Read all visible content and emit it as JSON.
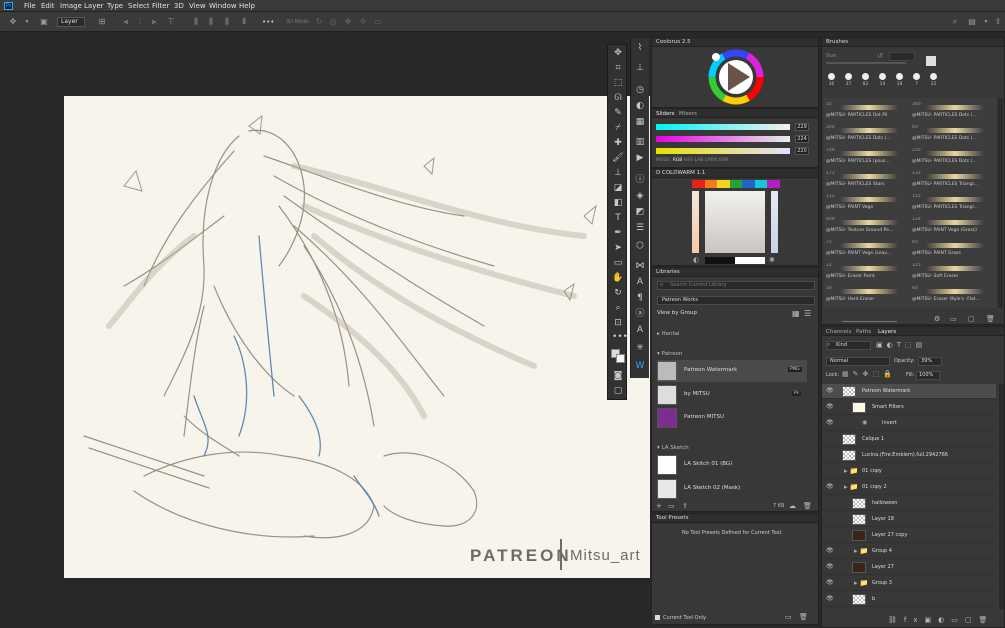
{
  "app": {
    "logo": "Ps"
  },
  "menu": [
    "File",
    "Edit",
    "Image",
    "Layer",
    "Type",
    "Select",
    "Filter",
    "3D",
    "View",
    "Window",
    "Help"
  ],
  "options": {
    "layer_select": "Layer",
    "mode_3d": "3D Mode:",
    "more": "•••"
  },
  "artwork": {
    "watermark_left": "PATREON",
    "watermark_right": "Mitsu_art"
  },
  "coolorus": {
    "title": "Coolorus 2.5"
  },
  "sliders": {
    "tab_active": "Sliders",
    "tab_other": "Mixers",
    "values": [
      "229",
      "224",
      "220"
    ],
    "modes": [
      "MODE:",
      "RGB",
      "HSV",
      "LAB",
      "CMYK",
      "B/W"
    ]
  },
  "swatch_panel": {
    "title": "D COLDWARM 1.1",
    "colors": [
      "#e8231b",
      "#f47c1c",
      "#f7d21e",
      "#22a338",
      "#1f64c8",
      "#13c9d6",
      "#b31fc2"
    ]
  },
  "libraries": {
    "title": "Libraries",
    "search_placeholder": "Search Current Library",
    "library_name": "Patreon Works",
    "view_by": "View by Group",
    "groups": [
      {
        "name": "Hentai",
        "items": []
      },
      {
        "name": "Patreon",
        "items": [
          {
            "label": "Patreon Watermark",
            "badge": "PNG"
          },
          {
            "label": "by MITSU",
            "badge": "Ps"
          },
          {
            "label": "Patreon MITSU",
            "badge": ""
          }
        ]
      },
      {
        "name": "LA Sketch",
        "items": [
          {
            "label": "LA Skitch 01 (BG)",
            "badge": ""
          },
          {
            "label": "LA Sketch 02 (Mask)",
            "badge": ""
          }
        ]
      }
    ],
    "footer_size": "7 KB"
  },
  "tool_presets": {
    "title": "Tool Presets",
    "empty_message": "No Tool Presets Defined for Current Tool.",
    "current_tool_only": "Current Tool Only"
  },
  "brushes": {
    "title": "Brushes",
    "size_label": "Size",
    "sizes": [
      "36",
      "37",
      "82",
      "14",
      "18",
      "7",
      "22"
    ],
    "rows": [
      {
        "num_left": "25",
        "left": "@MITSU- PARTICLES Dot Pil",
        "num_right": "360",
        "right": "@MITSU- PARTICLES Dots (..."
      },
      {
        "num_left": "204",
        "left": "@MITSU- PARTICLES Dots (...",
        "num_right": "60",
        "right": "@MITSU- PARTICLES Dots (..."
      },
      {
        "num_left": "749",
        "left": "@MITSU- PARTICLES (pous...",
        "num_right": "250",
        "right": "@MITSU- PARTICLES Dots (..."
      },
      {
        "num_left": "173",
        "left": "@MITSU- PARTICLES Stars",
        "num_right": "133",
        "right": "@MITSU- PARTICLES Triangl..."
      },
      {
        "num_left": "112",
        "left": "@MITSU- PAINT Vege",
        "num_right": "155",
        "right": "@MITSU- PARTICLES Triangl..."
      },
      {
        "num_left": "409",
        "left": "@MITSU- Texture Ground Pe...",
        "num_right": "124",
        "right": "@MITSU- PAINT Vege (Grass)"
      },
      {
        "num_left": "75",
        "left": "@MITSU- PAINT Vege (Leav...",
        "num_right": "60",
        "right": "@MITSU- PAINT Grass"
      },
      {
        "num_left": "12",
        "left": "@MITSU- Eraser Paint",
        "num_right": "125",
        "right": "@MITSU- Soft Eraser"
      },
      {
        "num_left": "30",
        "left": "@MITSU- Hard Eraser",
        "num_right": "60",
        "right": "@MITSU- Eraser (Kyle's -Flat..."
      }
    ]
  },
  "layers": {
    "tabs": [
      "Channels",
      "Paths",
      "Layers"
    ],
    "kind": "Kind",
    "blend": "Normal",
    "opacity_label": "Opacity:",
    "opacity": "39%",
    "lock_label": "Lock:",
    "fill_label": "Fill:",
    "fill": "100%",
    "items": [
      {
        "name": "Patreon Watermark",
        "visible": true,
        "indent": 0,
        "thumb": "checker"
      },
      {
        "name": "Smart Filters",
        "visible": true,
        "indent": 1,
        "thumb": "white"
      },
      {
        "name": "Invert",
        "visible": true,
        "indent": 2,
        "thumb": "none"
      },
      {
        "name": "Calque 1",
        "visible": false,
        "indent": 0,
        "thumb": "checker"
      },
      {
        "name": "Lucina.(Fire.Emblem).full.2942766",
        "visible": false,
        "indent": 0,
        "thumb": "checker"
      },
      {
        "name": "01 copy",
        "visible": false,
        "indent": 0,
        "thumb": "folder"
      },
      {
        "name": "01 copy 2",
        "visible": true,
        "indent": 0,
        "thumb": "folder"
      },
      {
        "name": "halloween",
        "visible": false,
        "indent": 1,
        "thumb": "checker"
      },
      {
        "name": "Layer 18",
        "visible": false,
        "indent": 1,
        "thumb": "checker"
      },
      {
        "name": "Layer 27 copy",
        "visible": false,
        "indent": 1,
        "thumb": "dark"
      },
      {
        "name": "Group 4",
        "visible": true,
        "indent": 1,
        "thumb": "folder"
      },
      {
        "name": "Layer 27",
        "visible": true,
        "indent": 1,
        "thumb": "dark"
      },
      {
        "name": "Group 3",
        "visible": true,
        "indent": 1,
        "thumb": "folder"
      },
      {
        "name": "b",
        "visible": true,
        "indent": 1,
        "thumb": "checker"
      }
    ]
  }
}
